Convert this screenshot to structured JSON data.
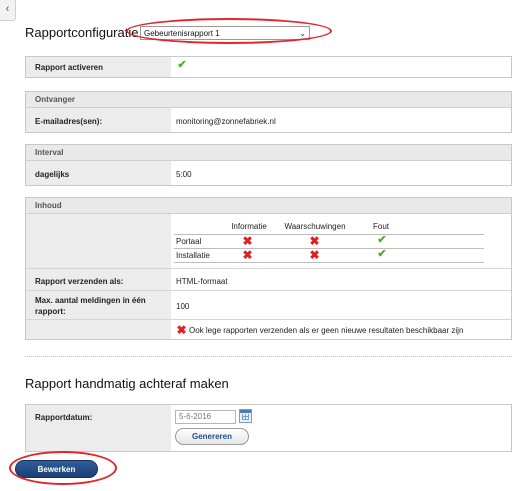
{
  "back_tab_glyph": "‹",
  "title": "Rapportconfiguratie",
  "report_select": {
    "value": "Gebeurtenisrapport 1",
    "chevron": "⌄"
  },
  "activate": {
    "label": "Rapport activeren",
    "icon": "check-icon"
  },
  "recipient": {
    "section_title": "Ontvanger",
    "email_label": "E-mailadres(sen):",
    "email_value": "monitoring@zonnefabriek.nl"
  },
  "interval": {
    "section_title": "Interval",
    "label": "dagelijks",
    "value": "5:00"
  },
  "content": {
    "section_title": "Inhoud",
    "columns": [
      "Informatie",
      "Waarschuwingen",
      "Fout"
    ],
    "rows": [
      {
        "label": "Portaal",
        "values": [
          "x",
          "x",
          "check"
        ]
      },
      {
        "label": "Installatie",
        "values": [
          "x",
          "x",
          "check"
        ]
      }
    ],
    "send_as_label": "Rapport verzenden als:",
    "send_as_value": "HTML-formaat",
    "max_label_line1": "Max. aantal meldingen in één",
    "max_label_line2": "rapport:",
    "max_value": "100",
    "empty_reports_text": "Ook lege rapporten verzenden als er geen nieuwe resultaten beschikbaar zijn",
    "empty_reports_icon": "x-icon"
  },
  "manual": {
    "title": "Rapport handmatig achteraf maken",
    "date_label": "Rapportdatum:",
    "date_placeholder": "5-6-2016",
    "generate_button": "Genereren"
  },
  "edit_button": "Bewerken",
  "colors": {
    "highlight": "#e0262b",
    "check_green": "#4caf2a",
    "x_red": "#e02020",
    "primary_button": "#1b3f72"
  }
}
